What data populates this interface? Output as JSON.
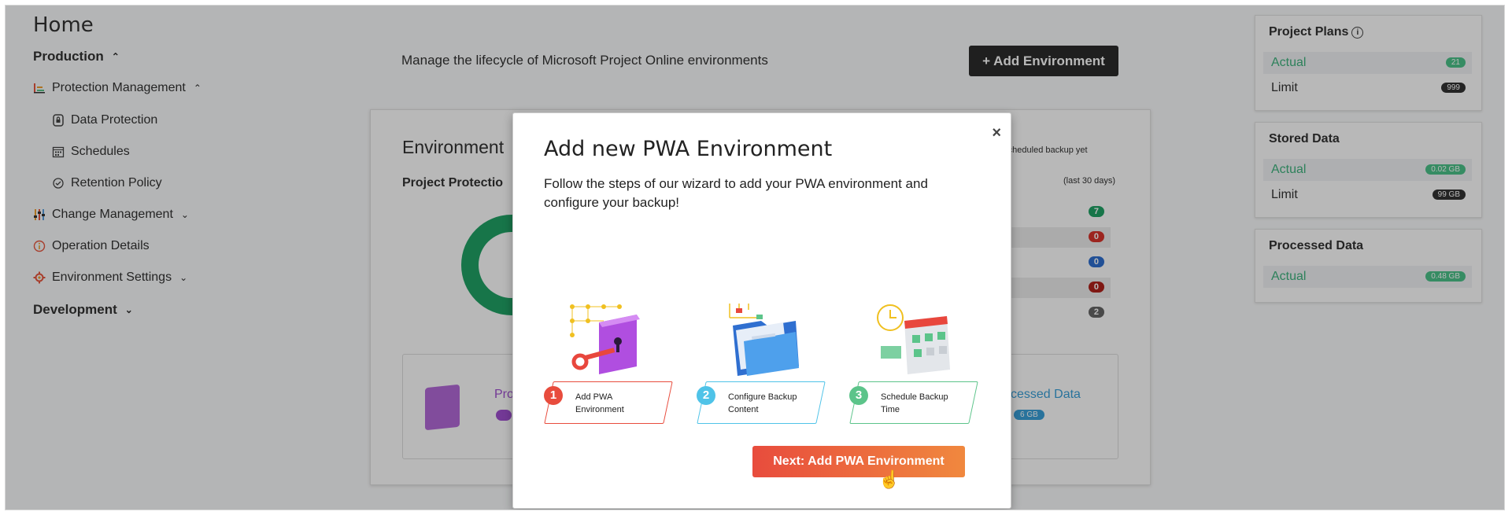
{
  "sidebar": {
    "home_title": "Home",
    "production": "Production",
    "protection_management": "Protection Management",
    "data_protection": "Data Protection",
    "schedules": "Schedules",
    "retention_policy": "Retention Policy",
    "change_management": "Change Management",
    "operation_details": "Operation Details",
    "environment_settings": "Environment Settings",
    "development": "Development"
  },
  "header": {
    "subtitle": "Manage the lifecycle of Microsoft Project Online environments",
    "add_environment_button": "+ Add Environment"
  },
  "main_card": {
    "heading": "Environment",
    "sub_heading": "Project Protectio",
    "no_backup_note": "o scheduled backup yet",
    "last_30_days": "(last 30 days)",
    "stat_badges": [
      "7",
      "0",
      "0",
      "0",
      "2"
    ],
    "prod_label": "Pro",
    "processed_label": "cessed Data",
    "processed_badge": "6 GB"
  },
  "right_panels": {
    "project_plans": {
      "title": "Project Plans",
      "actual_label": "Actual",
      "actual_value": "21",
      "limit_label": "Limit",
      "limit_value": "999"
    },
    "stored_data": {
      "title": "Stored Data",
      "actual_label": "Actual",
      "actual_value": "0.02 GB",
      "limit_label": "Limit",
      "limit_value": "99 GB"
    },
    "processed_data": {
      "title": "Processed Data",
      "actual_label": "Actual",
      "actual_value": "0.48 GB"
    }
  },
  "modal": {
    "close": "×",
    "title": "Add new PWA Environment",
    "description": "Follow the steps of our wizard to add your PWA environment and configure your backup!",
    "steps": [
      {
        "number": "1",
        "label": "Add PWA Environment",
        "color": "#e84c3d"
      },
      {
        "number": "2",
        "label": "Configure Backup Content",
        "color": "#4fc3e8"
      },
      {
        "number": "3",
        "label": "Schedule Backup Time",
        "color": "#5cc48a"
      }
    ],
    "next_button": "Next: Add PWA Environment"
  },
  "colors": {
    "green": "#21a366",
    "accent_red": "#e84c3d",
    "accent_orange": "#f0883e",
    "dark_button": "#2b2b2b"
  }
}
